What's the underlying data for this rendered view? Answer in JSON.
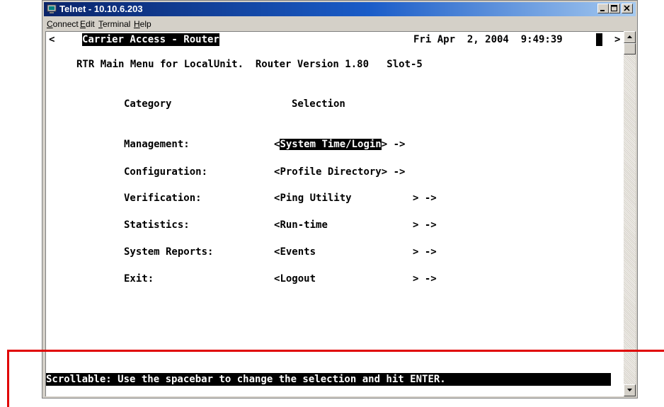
{
  "window": {
    "title": "Telnet - 10.10.6.203",
    "menu": [
      "Connect",
      "Edit",
      "Terminal",
      "Help"
    ]
  },
  "terminal": {
    "scroll_left": "<",
    "scroll_right": ">",
    "product": "Carrier Access - Router",
    "datetime": "Fri Apr  2, 2004  9:49:39",
    "heading": "RTR Main Menu for LocalUnit.  Router Version 1.80   Slot-5",
    "col_category": "Category",
    "col_selection": "Selection",
    "rows": [
      {
        "category": "Management:",
        "selection": "System Time/Login",
        "selected": true
      },
      {
        "category": "Configuration:",
        "selection": "Profile Directory",
        "selected": false
      },
      {
        "category": "Verification:",
        "selection": "Ping Utility",
        "selected": false
      },
      {
        "category": "Statistics:",
        "selection": "Run-time",
        "selected": false
      },
      {
        "category": "System Reports:",
        "selection": "Events",
        "selected": false
      },
      {
        "category": "Exit:",
        "selection": "Logout",
        "selected": false
      }
    ],
    "status": "Scrollable: Use the spacebar to change the selection and hit ENTER."
  },
  "colors": {
    "highlight_box": "#e00000",
    "terminal_bg": "#ffffff",
    "inverse_bg": "#000000",
    "title_gradient_start": "#0a246a"
  },
  "icons": [
    "telnet-app-icon",
    "minimize-icon",
    "maximize-icon",
    "close-icon",
    "scroll-up-arrow-icon",
    "scroll-down-arrow-icon"
  ]
}
